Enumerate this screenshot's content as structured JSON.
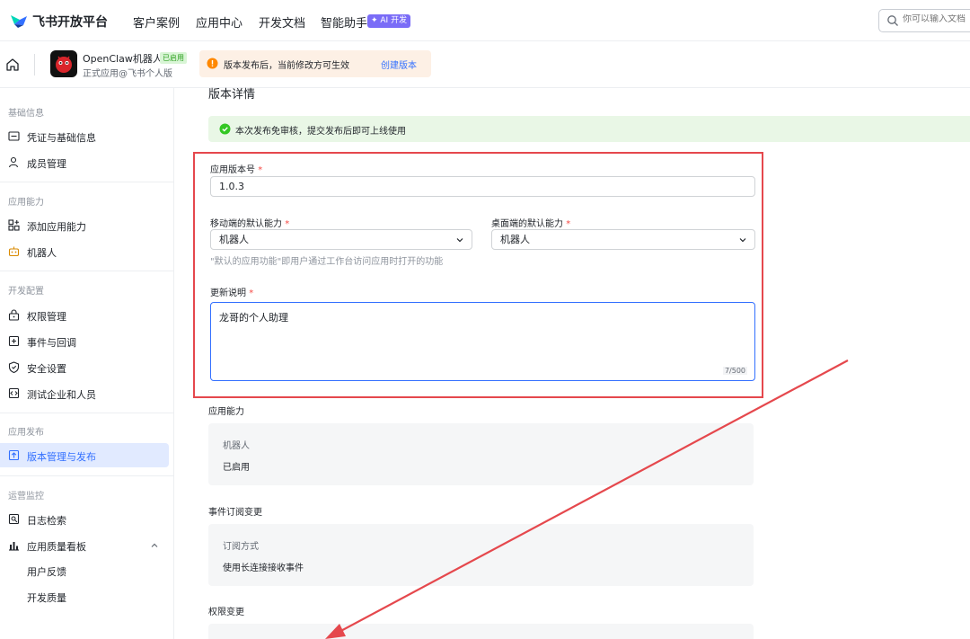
{
  "topnav": {
    "brand": "飞书开放平台",
    "items": [
      "客户案例",
      "应用中心",
      "开发文档",
      "智能助手"
    ],
    "ai_badge": "✦ AI 开发",
    "search_placeholder": "你可以输入文档"
  },
  "app_header": {
    "app_name": "OpenClaw机器人",
    "status_badge": "已启用",
    "app_sub": "正式应用@飞书个人版",
    "notice_text": "版本发布后，当前修改方可生效",
    "create_version": "创建版本"
  },
  "sidebar": {
    "sections": [
      {
        "title": "基础信息",
        "items": [
          "凭证与基础信息",
          "成员管理"
        ]
      },
      {
        "title": "应用能力",
        "items": [
          "添加应用能力",
          "机器人"
        ]
      },
      {
        "title": "开发配置",
        "items": [
          "权限管理",
          "事件与回调",
          "安全设置",
          "测试企业和人员"
        ]
      },
      {
        "title": "应用发布",
        "items": [
          "版本管理与发布"
        ]
      },
      {
        "title": "运营监控",
        "items": [
          "日志检索",
          "应用质量看板",
          "用户反馈",
          "开发质量"
        ]
      }
    ]
  },
  "main": {
    "page_title": "版本详情",
    "success_text": "本次发布免审核，提交发布后即可上线使用",
    "form": {
      "version_label": "应用版本号",
      "version_value": "1.0.3",
      "mobile_label": "移动端的默认能力",
      "mobile_value": "机器人",
      "desktop_label": "桌面端的默认能力",
      "desktop_value": "机器人",
      "hint": "\"默认的应用功能\"即用户通过工作台访问应用时打开的功能",
      "notes_label": "更新说明",
      "notes_value": "龙哥的个人助理",
      "notes_counter": "7/500",
      "required_mark": "*"
    },
    "capability": {
      "title": "应用能力",
      "name": "机器人",
      "status": "已启用"
    },
    "event_change": {
      "title": "事件订阅变更",
      "key": "订阅方式",
      "value": "使用长连接接收事件"
    },
    "permission_change": {
      "title": "权限变更"
    }
  },
  "colors": {
    "primary": "#3370ff",
    "highlight_border": "#e5484d",
    "success_bg": "#e9f7e6",
    "warning_bg": "#fdf0e5"
  }
}
